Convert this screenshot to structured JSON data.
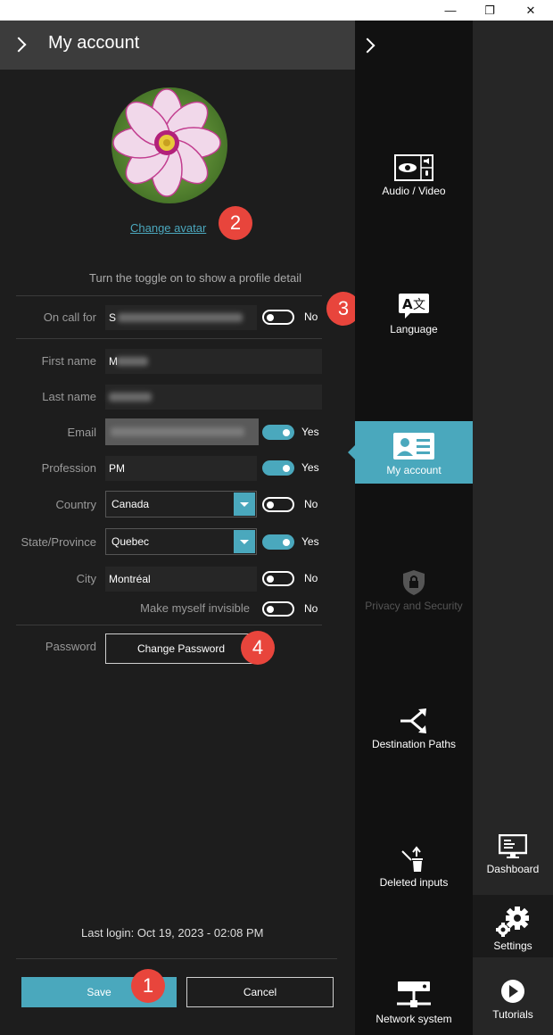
{
  "window": {
    "minimize": "—",
    "restore": "❐",
    "close": "✕"
  },
  "panel": {
    "title": "My account",
    "change_avatar": "Change avatar",
    "hint": "Turn the toggle on to show a profile detail",
    "fields": {
      "on_call_for": {
        "label": "On call for",
        "value": "S",
        "toggle": "No",
        "toggle_on": false
      },
      "first_name": {
        "label": "First name",
        "value": "M"
      },
      "last_name": {
        "label": "Last name",
        "value": ""
      },
      "email": {
        "label": "Email",
        "value": "",
        "toggle": "Yes",
        "toggle_on": true
      },
      "profession": {
        "label": "Profession",
        "value": "PM",
        "toggle": "Yes",
        "toggle_on": true
      },
      "country": {
        "label": "Country",
        "value": "Canada",
        "toggle": "No",
        "toggle_on": false
      },
      "state": {
        "label": "State/Province",
        "value": "Quebec",
        "toggle": "Yes",
        "toggle_on": true
      },
      "city": {
        "label": "City",
        "value": "Montréal",
        "toggle": "No",
        "toggle_on": false
      },
      "invisible": {
        "label": "Make myself invisible",
        "toggle": "No",
        "toggle_on": false
      },
      "password": {
        "label": "Password",
        "button": "Change Password"
      }
    },
    "last_login": "Last login: Oct 19, 2023 - 02:08 PM",
    "save": "Save",
    "cancel": "Cancel"
  },
  "badges": {
    "b1": "1",
    "b2": "2",
    "b3": "3",
    "b4": "4"
  },
  "colors": {
    "accent": "#4aa8bd",
    "badge": "#e8453c",
    "link": "#4ba7bd"
  },
  "nav": {
    "audio_video": "Audio / Video",
    "language": "Language",
    "my_account": "My account",
    "privacy": "Privacy and Security",
    "destination": "Destination Paths",
    "deleted": "Deleted inputs",
    "network": "Network system"
  },
  "rightnav": {
    "dashboard": "Dashboard",
    "settings": "Settings",
    "tutorials": "Tutorials"
  }
}
